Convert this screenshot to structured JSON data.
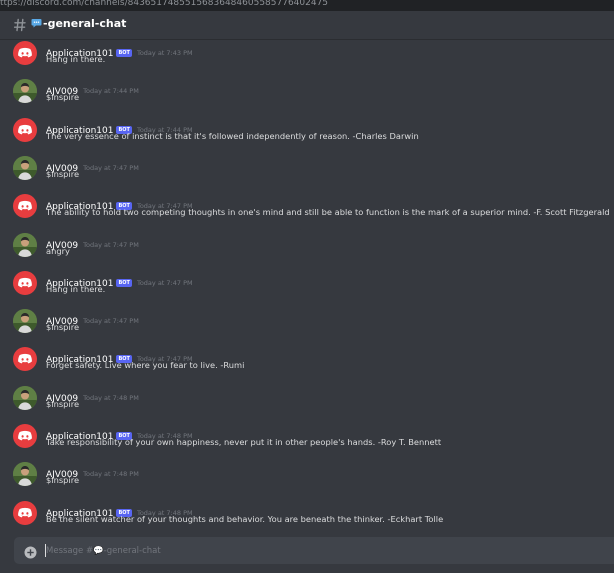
{
  "browser": {
    "url": "ttps://discord.com/channels/84365174855156836484605585776402475"
  },
  "channel": {
    "name": "-general-chat"
  },
  "messages": [
    {
      "author": "Application101",
      "bot": true,
      "badge": "BOT",
      "time": "Today at 7:43 PM",
      "text": "Hang in there."
    },
    {
      "author": "AJV009",
      "bot": false,
      "time": "Today at 7:44 PM",
      "text": "$inspire"
    },
    {
      "author": "Application101",
      "bot": true,
      "badge": "BOT",
      "time": "Today at 7:44 PM",
      "text": "The very essence of instinct is that it's followed independently of reason. -Charles Darwin"
    },
    {
      "author": "AJV009",
      "bot": false,
      "time": "Today at 7:47 PM",
      "text": "$inspire"
    },
    {
      "author": "Application101",
      "bot": true,
      "badge": "BOT",
      "time": "Today at 7:47 PM",
      "text": "The ability to hold two competing thoughts in one's mind and still be able to function is the mark of a superior mind. -F. Scott Fitzgerald"
    },
    {
      "author": "AJV009",
      "bot": false,
      "time": "Today at 7:47 PM",
      "text": "angry"
    },
    {
      "author": "Application101",
      "bot": true,
      "badge": "BOT",
      "time": "Today at 7:47 PM",
      "text": "Hang in there."
    },
    {
      "author": "AJV009",
      "bot": false,
      "time": "Today at 7:47 PM",
      "text": "$inspire"
    },
    {
      "author": "Application101",
      "bot": true,
      "badge": "BOT",
      "time": "Today at 7:47 PM",
      "text": "Forget safety. Live where you fear to live. -Rumi"
    },
    {
      "author": "AJV009",
      "bot": false,
      "time": "Today at 7:48 PM",
      "text": "$inspire"
    },
    {
      "author": "Application101",
      "bot": true,
      "badge": "BOT",
      "time": "Today at 7:48 PM",
      "text": "Take responsibility of your own happiness, never put it in other people's hands. -Roy T. Bennett"
    },
    {
      "author": "AJV009",
      "bot": false,
      "time": "Today at 7:48 PM",
      "text": "$inspire"
    },
    {
      "author": "Application101",
      "bot": true,
      "badge": "BOT",
      "time": "Today at 7:48 PM",
      "text": "Be the silent watcher of your thoughts and behavior. You are beneath the thinker. -Eckhart Tolle"
    }
  ],
  "composer": {
    "placeholder": "Message #💬-general-chat",
    "attach_icon": "plus-circle-icon"
  },
  "icons": {
    "channel": "hash-icon",
    "channel_emoji": "speech-bubble-icon",
    "bot_avatar": "discord-logo-icon",
    "user_avatar": "user-photo-avatar"
  },
  "colors": {
    "background": "#36393f",
    "bot_badge": "#5865f2",
    "bot_avatar": "#e83d3f",
    "composer": "#40444b"
  }
}
